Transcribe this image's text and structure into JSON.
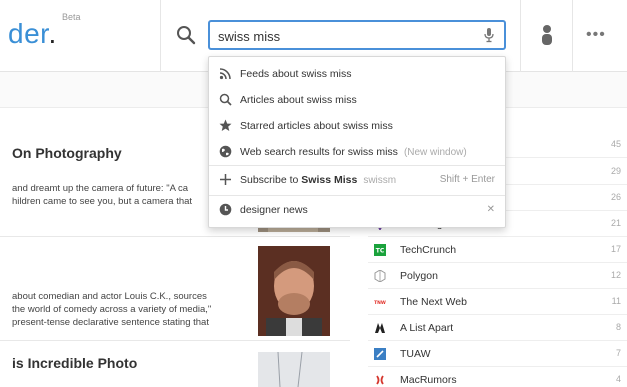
{
  "header": {
    "logo_text": "der",
    "logo_dot": ".",
    "beta_label": "Beta",
    "search_value": "swiss miss",
    "icons": [
      "search-icon",
      "microphone-icon",
      "user-icon",
      "more-icon"
    ],
    "more_glyph": "•••",
    "accent_color": "#4a90d9"
  },
  "dropdown": {
    "items": [
      {
        "icon": "rss-icon",
        "label": "Feeds about swiss miss"
      },
      {
        "icon": "search-icon",
        "label": "Articles about swiss miss"
      },
      {
        "icon": "star-icon",
        "label": "Starred articles about swiss miss"
      },
      {
        "icon": "globe-icon",
        "label": "Web search results for swiss miss",
        "extra": "(New window)"
      }
    ],
    "subscribe": {
      "icon": "plus-icon",
      "prefix": "Subscribe to ",
      "name": "Swiss Miss",
      "faded": "swissm",
      "shortcut": "Shift + Enter"
    },
    "history": {
      "icon": "clock-icon",
      "label": "designer news",
      "remove_glyph": "✕"
    }
  },
  "articles": [
    {
      "title": "On Photography",
      "lines": [
        "and dreamt up the camera of future: \"A ca",
        "hildren came to see you, but a camera that"
      ]
    },
    {
      "title": "",
      "lines": [
        "about comedian and actor Louis C.K., sources",
        "the world of comedy across a variety of media,\"",
        "present-tense declarative sentence stating that"
      ]
    },
    {
      "title": "is Incredible Photo",
      "lines": []
    }
  ],
  "feeds": [
    {
      "name": "",
      "count": "45"
    },
    {
      "name": "",
      "count": "29"
    },
    {
      "name": "",
      "count": "26"
    },
    {
      "name": "The Verge",
      "count": "21",
      "icon": "verge-icon"
    },
    {
      "name": "TechCrunch",
      "count": "17",
      "icon": "techcrunch-icon"
    },
    {
      "name": "Polygon",
      "count": "12",
      "icon": "polygon-icon"
    },
    {
      "name": "The Next Web",
      "count": "11",
      "icon": "tnw-icon"
    },
    {
      "name": "A List Apart",
      "count": "8",
      "icon": "alistapart-icon"
    },
    {
      "name": "TUAW",
      "count": "7",
      "icon": "tuaw-icon"
    },
    {
      "name": "MacRumors",
      "count": "4",
      "icon": "macrumors-icon"
    }
  ],
  "feed_icon_text": {
    "techcrunch": "TC",
    "tnw": "TNW"
  }
}
